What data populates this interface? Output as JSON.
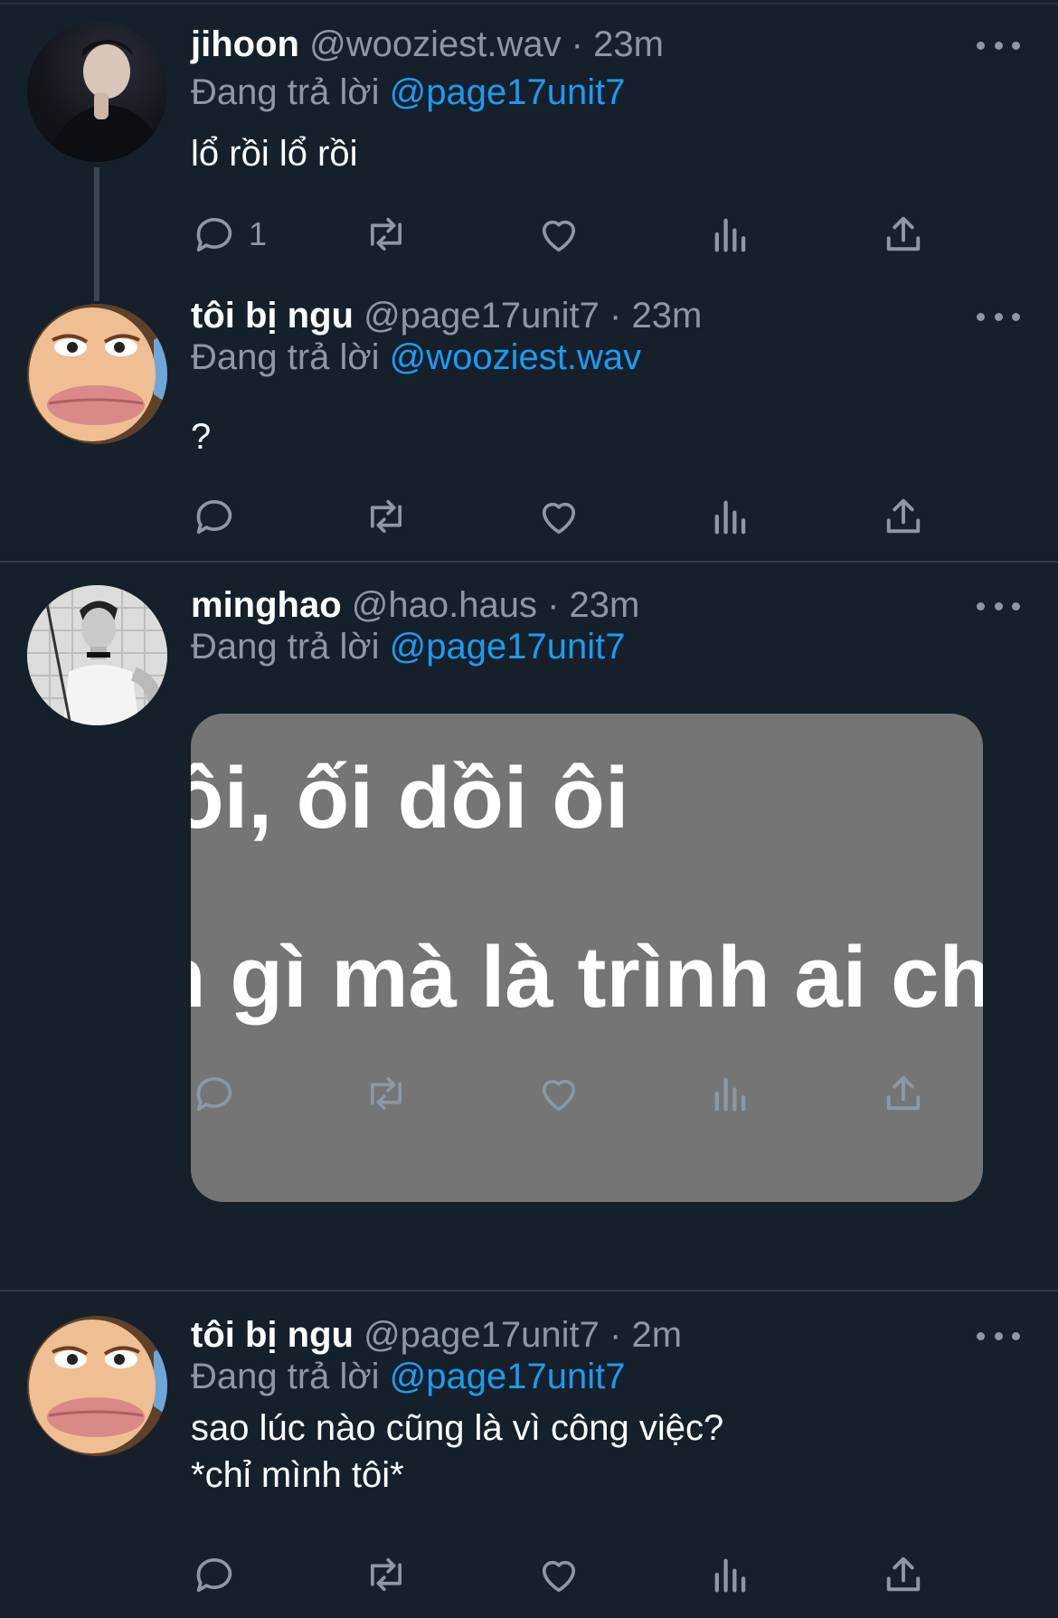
{
  "tweets": [
    {
      "name": "jihoon",
      "meta": "@wooziest.wav · 23m",
      "replying_prefix": "Đang trả lời",
      "replying_to": "@page17unit7",
      "text": "lổ rồi lổ rồi",
      "reply_count": "1"
    },
    {
      "name": "tôi bị ngu",
      "meta": "@page17unit7 · 23m",
      "replying_prefix": "Đang trả lời",
      "replying_to": "@wooziest.wav",
      "text": "?",
      "reply_count": ""
    },
    {
      "name": "minghao",
      "meta": "@hao.haus · 23m",
      "replying_prefix": "Đang trả lời",
      "replying_to": "@page17unit7",
      "media_lines": [
        "ồi, ối dồi ôi",
        "n gì mà là trình ai châ"
      ],
      "reply_count": ""
    },
    {
      "name": "tôi bị ngu",
      "meta": "@page17unit7 · 2m",
      "replying_prefix": "Đang trả lời",
      "replying_to": "@page17unit7",
      "text": "sao lúc nào cũng là vì công việc?\n*chỉ mình tôi*",
      "reply_count": ""
    }
  ],
  "icons": {
    "reply": "reply-icon",
    "retweet": "retweet-icon",
    "like": "heart-icon",
    "views": "views-icon",
    "share": "share-icon",
    "more": "more-icon"
  },
  "colors": {
    "background": "#15202b",
    "mention": "#1d9bf0",
    "muted": "#8b98a5"
  }
}
